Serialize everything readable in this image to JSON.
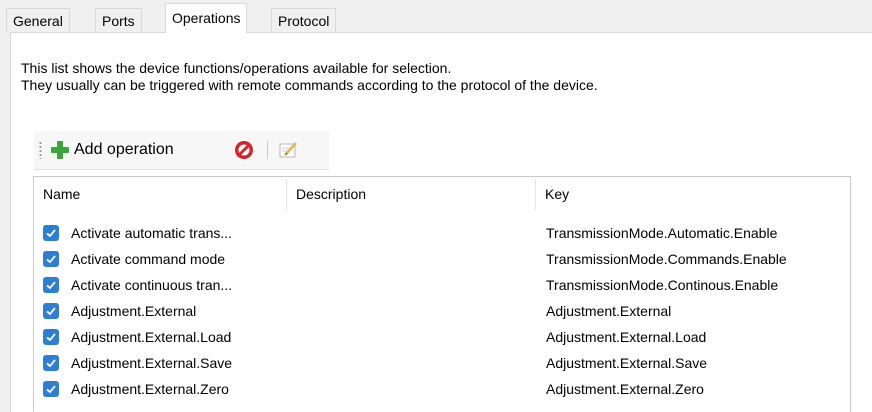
{
  "tabs": [
    {
      "label": "General",
      "active": false
    },
    {
      "label": "Ports",
      "active": false
    },
    {
      "label": "Operations",
      "active": true
    },
    {
      "label": "Protocol",
      "active": false
    }
  ],
  "description": {
    "line1": "This list shows the device functions/operations available for selection.",
    "line2": "They usually can be triggered with remote commands according to the protocol of the device."
  },
  "toolbar": {
    "add_label": "Add operation",
    "delete_icon": "delete-icon",
    "edit_icon": "edit-icon"
  },
  "columns": [
    "Name",
    "Description",
    "Key"
  ],
  "rows": [
    {
      "checked": true,
      "name": "Activate automatic trans...",
      "description": "",
      "key": "TransmissionMode.Automatic.Enable"
    },
    {
      "checked": true,
      "name": "Activate command mode",
      "description": "",
      "key": "TransmissionMode.Commands.Enable"
    },
    {
      "checked": true,
      "name": "Activate continuous tran...",
      "description": "",
      "key": "TransmissionMode.Continous.Enable"
    },
    {
      "checked": true,
      "name": "Adjustment.External",
      "description": "",
      "key": "Adjustment.External"
    },
    {
      "checked": true,
      "name": "Adjustment.External.Load",
      "description": "",
      "key": "Adjustment.External.Load"
    },
    {
      "checked": true,
      "name": "Adjustment.External.Save",
      "description": "",
      "key": "Adjustment.External.Save"
    },
    {
      "checked": true,
      "name": "Adjustment.External.Zero",
      "description": "",
      "key": "Adjustment.External.Zero"
    }
  ],
  "colors": {
    "checkbox": "#2d7fd3",
    "add_icon": "#3aa53a",
    "delete_icon": "#d6232b"
  }
}
